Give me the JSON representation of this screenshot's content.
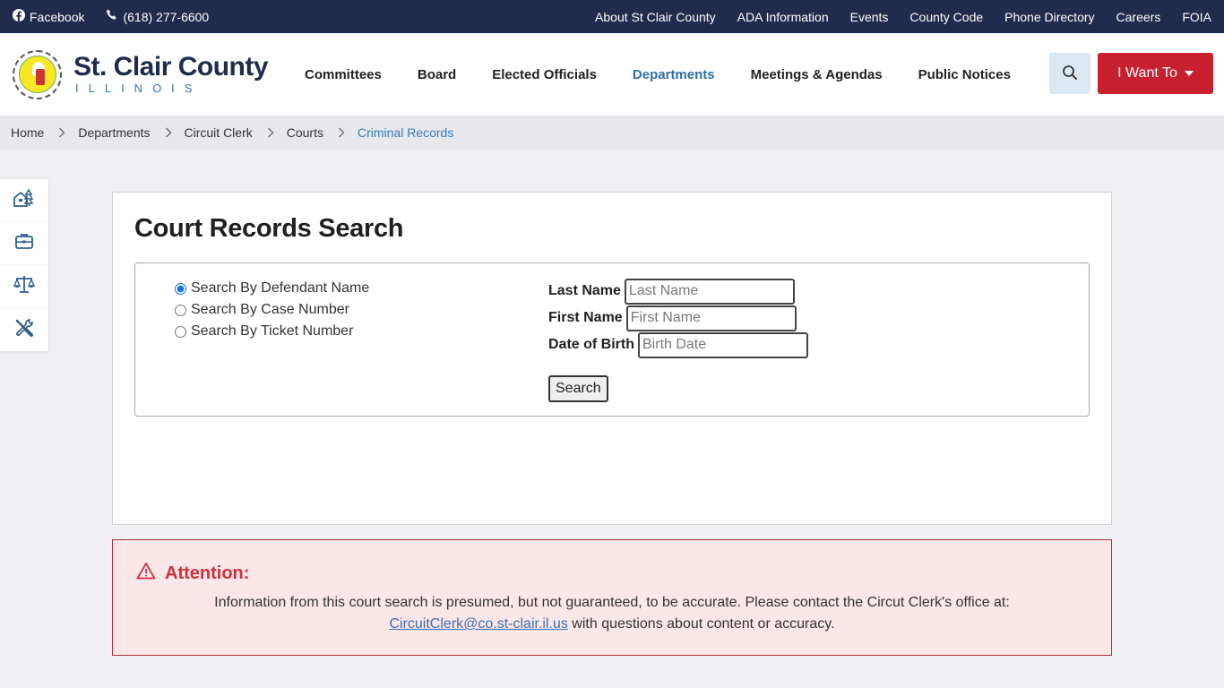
{
  "topbar": {
    "facebook_label": "Facebook",
    "phone_label": "(618) 277-6600",
    "links": [
      "About St Clair County",
      "ADA Information",
      "Events",
      "County Code",
      "Phone Directory",
      "Careers",
      "FOIA"
    ]
  },
  "header": {
    "logo_title": "St. Clair County",
    "logo_subtitle": "ILLINOIS",
    "nav": [
      {
        "label": "Committees",
        "active": false
      },
      {
        "label": "Board",
        "active": false
      },
      {
        "label": "Elected Officials",
        "active": false
      },
      {
        "label": "Departments",
        "active": true
      },
      {
        "label": "Meetings & Agendas",
        "active": false
      },
      {
        "label": "Public Notices",
        "active": false
      }
    ],
    "search_icon": "search-icon",
    "i_want_to_label": "I Want To"
  },
  "breadcrumb": [
    "Home",
    "Departments",
    "Circuit Clerk",
    "Courts",
    "Criminal Records"
  ],
  "side_links": [
    "home-tree-icon",
    "briefcase-icon",
    "scales-icon",
    "tools-icon"
  ],
  "main": {
    "title": "Court Records Search",
    "radios": [
      {
        "label": "Search By Defendant Name",
        "checked": true
      },
      {
        "label": "Search By Case Number",
        "checked": false
      },
      {
        "label": "Search By Ticket Number",
        "checked": false
      }
    ],
    "fields": [
      {
        "label": "Last Name",
        "placeholder": "Last Name",
        "value": ""
      },
      {
        "label": "First Name",
        "placeholder": "First Name",
        "value": ""
      },
      {
        "label": "Date of Birth",
        "placeholder": "Birth Date",
        "value": ""
      }
    ],
    "search_button": "Search"
  },
  "attention": {
    "title": "Attention:",
    "text_1": "Information from this court search is presumed, but not guaranteed, to be accurate. Please contact the Circut Clerk's office at:",
    "email": "CircuitClerk@co.st-clair.il.us",
    "text_2": " with questions about content or accuracy."
  },
  "colors": {
    "topbar_bg": "#202c4d",
    "accent_blue": "#2e6fa5",
    "brand_red": "#c8202f",
    "attention_bg": "#fbe6e8"
  }
}
